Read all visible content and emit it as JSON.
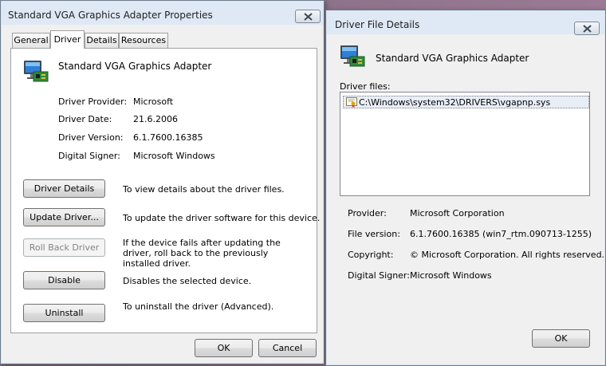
{
  "properties_dialog": {
    "title": "Standard VGA Graphics Adapter Properties",
    "tabs": [
      {
        "label": "General"
      },
      {
        "label": "Driver",
        "active": true
      },
      {
        "label": "Details"
      },
      {
        "label": "Resources"
      }
    ],
    "device_name": "Standard VGA Graphics Adapter",
    "info": [
      {
        "label": "Driver Provider:",
        "value": "Microsoft"
      },
      {
        "label": "Driver Date:",
        "value": "21.6.2006"
      },
      {
        "label": "Driver Version:",
        "value": "6.1.7600.16385"
      },
      {
        "label": "Digital Signer:",
        "value": "Microsoft Windows"
      }
    ],
    "actions": [
      {
        "button": "Driver Details",
        "description": "To view details about the driver files.",
        "enabled": true
      },
      {
        "button": "Update Driver...",
        "description": "To update the driver software for this device.",
        "enabled": true
      },
      {
        "button": "Roll Back Driver",
        "description": "If the device fails after updating the driver, roll back to the previously installed driver.",
        "enabled": false
      },
      {
        "button": "Disable",
        "description": "Disables the selected device.",
        "enabled": true
      },
      {
        "button": "Uninstall",
        "description": "To uninstall the driver (Advanced).",
        "enabled": true
      }
    ],
    "ok_label": "OK",
    "cancel_label": "Cancel"
  },
  "file_details_dialog": {
    "title": "Driver File Details",
    "device_name": "Standard VGA Graphics Adapter",
    "files_label": "Driver files:",
    "files": [
      "C:\\Windows\\system32\\DRIVERS\\vgapnp.sys"
    ],
    "details": [
      {
        "label": "Provider:",
        "value": "Microsoft Corporation"
      },
      {
        "label": "File version:",
        "value": "6.1.7600.16385 (win7_rtm.090713-1255)"
      },
      {
        "label": "Copyright:",
        "value": "© Microsoft Corporation. All rights reserved."
      },
      {
        "label": "Digital Signer:",
        "value": "Microsoft Windows"
      }
    ],
    "ok_label": "OK"
  },
  "colors": {
    "title_gradient": "#dfe9f5",
    "dialog_face": "#f0f0f0",
    "selection": "#e8eef6",
    "desktop": "#8a6f86"
  },
  "icons": {
    "device": "display-adapter-icon",
    "file": "certificate-file-icon",
    "close": "close-icon"
  }
}
